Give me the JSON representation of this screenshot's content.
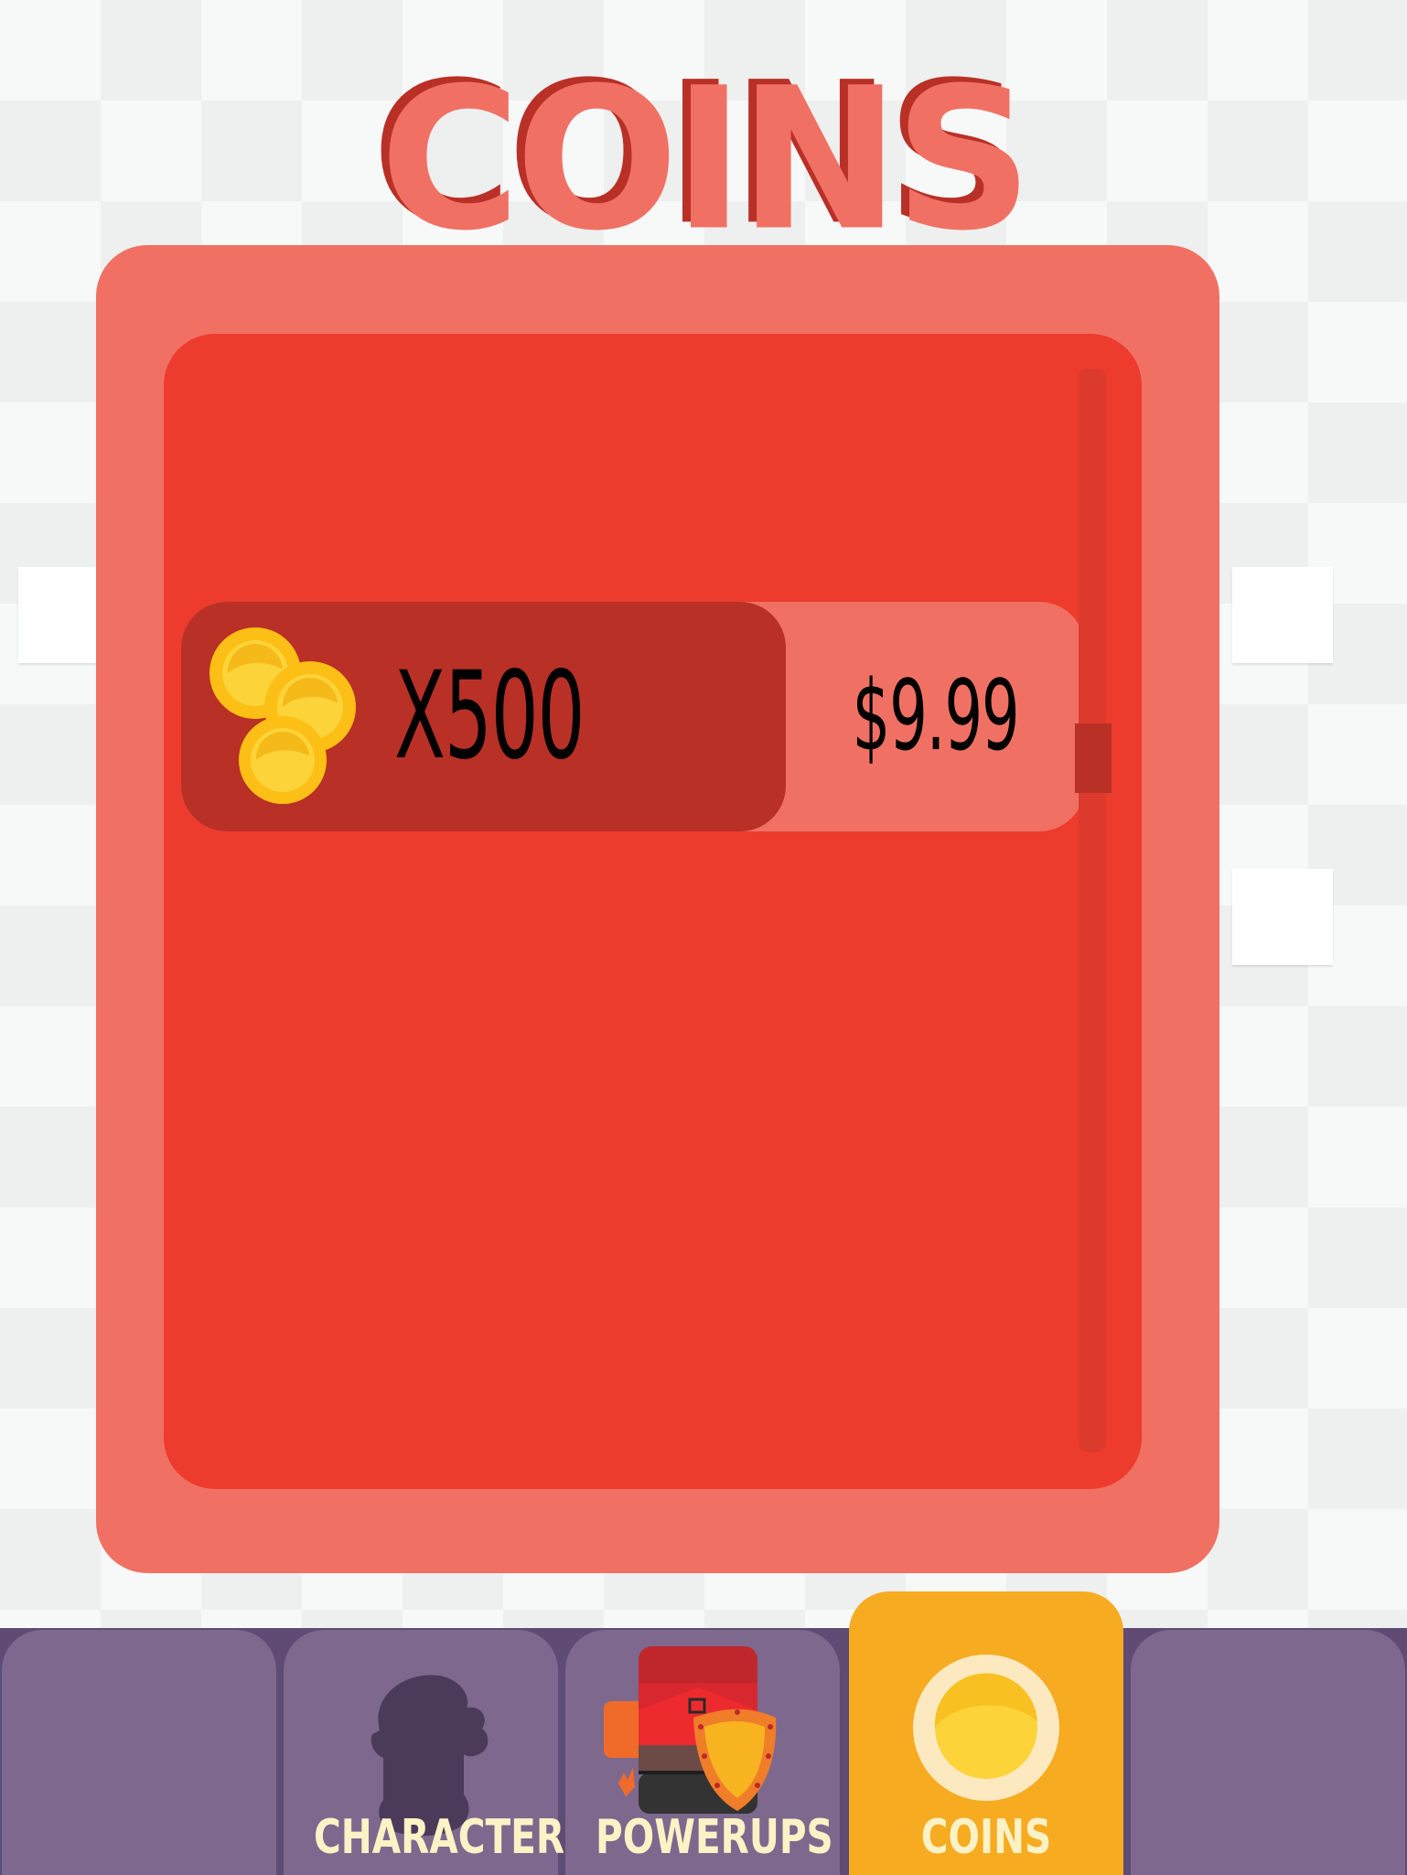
{
  "title": "COINS",
  "offers": [
    {
      "amount_label": "X500",
      "price": "$9.99",
      "icon": "coin-stack-icon"
    }
  ],
  "scroll": {
    "position_fraction": 0.35
  },
  "tabs": [
    {
      "label": "",
      "icon": ""
    },
    {
      "label": "CHARACTERS",
      "icon": "character-silhouette-icon"
    },
    {
      "label": "POWERUPS",
      "icon": "backpack-shield-icon"
    },
    {
      "label": "COINS",
      "icon": "coin-icon",
      "active": true
    },
    {
      "label": "",
      "icon": ""
    }
  ],
  "colors": {
    "panel_outer": "#f07163",
    "panel_inner": "#ed3b2d",
    "dark_red": "#b93026",
    "tab_bg": "#7e688d",
    "tab_active": "#f7ab21",
    "tab_label": "#fdf2c6",
    "coin": "#fdd33a"
  }
}
